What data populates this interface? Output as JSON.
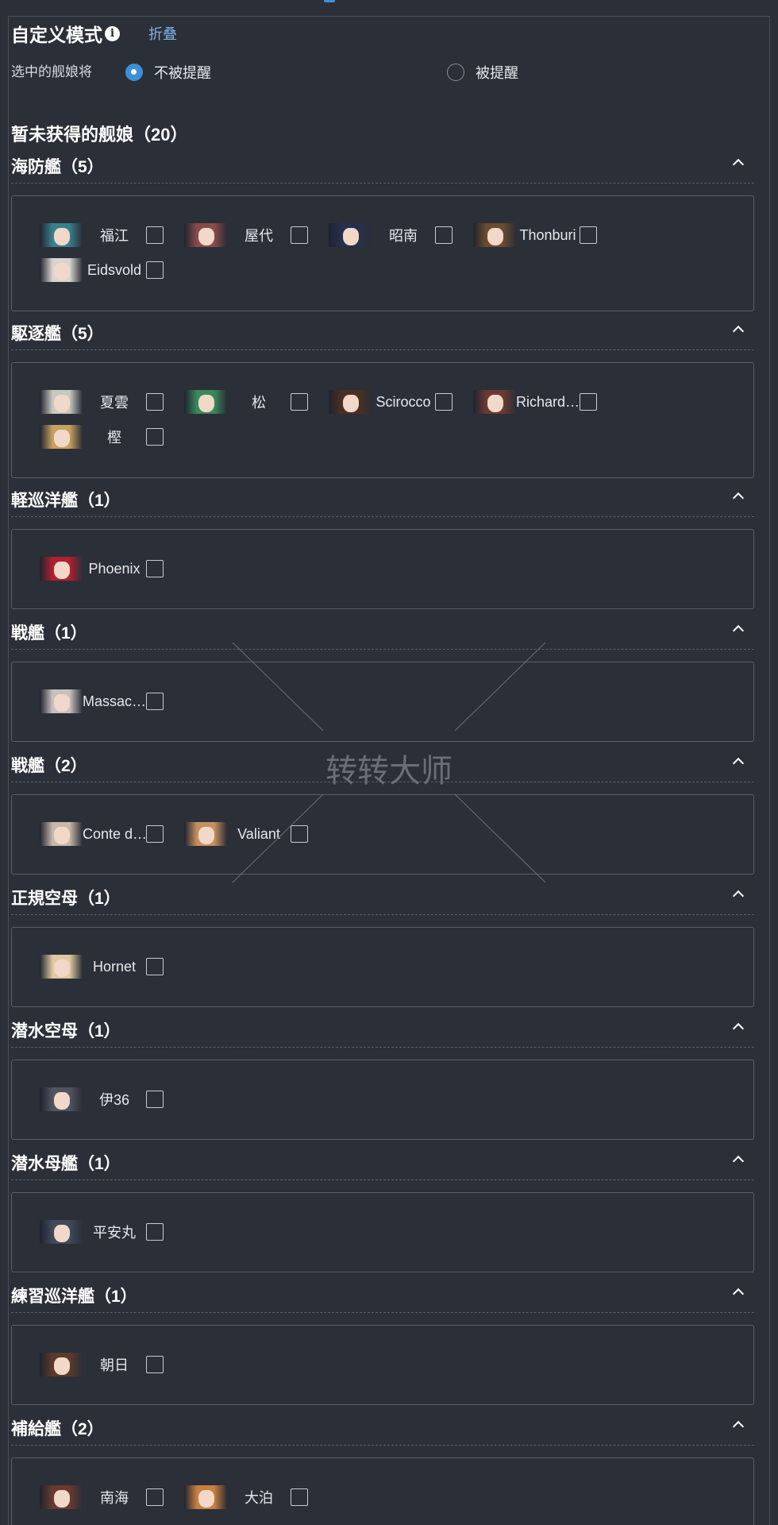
{
  "header": {
    "title": "自定义模式",
    "fold_label": "折叠"
  },
  "mode": {
    "label": "选中的舰娘将",
    "option_no_remind": "不被提醒",
    "option_remind": "被提醒",
    "selected": "不被提醒"
  },
  "subtitle": "暂未获得的舰娘（20）",
  "sections": [
    {
      "title": "海防艦（5）",
      "ships": [
        {
          "name": "福江",
          "hair": "#3a7f8c"
        },
        {
          "name": "屋代",
          "hair": "#8a4a4a"
        },
        {
          "name": "昭南",
          "hair": "#26304a"
        },
        {
          "name": "Thonburi",
          "hair": "#6a4a30"
        },
        {
          "name": "Eidsvold",
          "hair": "#d8d4d0"
        }
      ]
    },
    {
      "title": "駆逐艦（5）",
      "ships": [
        {
          "name": "夏雲",
          "hair": "#c8c8c0"
        },
        {
          "name": "松",
          "hair": "#3a8a5a"
        },
        {
          "name": "Scirocco",
          "hair": "#4a3020"
        },
        {
          "name": "Richard…",
          "hair": "#6a3a30"
        },
        {
          "name": "樫",
          "hair": "#c8a060"
        }
      ]
    },
    {
      "title": "軽巡洋艦（1）",
      "ships": [
        {
          "name": "Phoenix",
          "hair": "#b02030"
        }
      ]
    },
    {
      "title": "戦艦（1）",
      "ships": [
        {
          "name": "Massac…",
          "hair": "#c8c0c0"
        }
      ]
    },
    {
      "title": "戦艦（2）",
      "ships": [
        {
          "name": "Conte d…",
          "hair": "#c8b8a8"
        },
        {
          "name": "Valiant",
          "hair": "#c89060"
        }
      ]
    },
    {
      "title": "正規空母（1）",
      "ships": [
        {
          "name": "Hornet",
          "hair": "#e0c8a0"
        }
      ]
    },
    {
      "title": "潜水空母（1）",
      "ships": [
        {
          "name": "伊36",
          "hair": "#505460"
        }
      ]
    },
    {
      "title": "潜水母艦（1）",
      "ships": [
        {
          "name": "平安丸",
          "hair": "#404a5a"
        }
      ]
    },
    {
      "title": "練習巡洋艦（1）",
      "ships": [
        {
          "name": "朝日",
          "hair": "#5a3a2a"
        }
      ]
    },
    {
      "title": "補給艦（2）",
      "ships": [
        {
          "name": "南海",
          "hair": "#6a3a30"
        },
        {
          "name": "大泊",
          "hair": "#c88040"
        }
      ]
    }
  ],
  "watermark": "转转大师"
}
